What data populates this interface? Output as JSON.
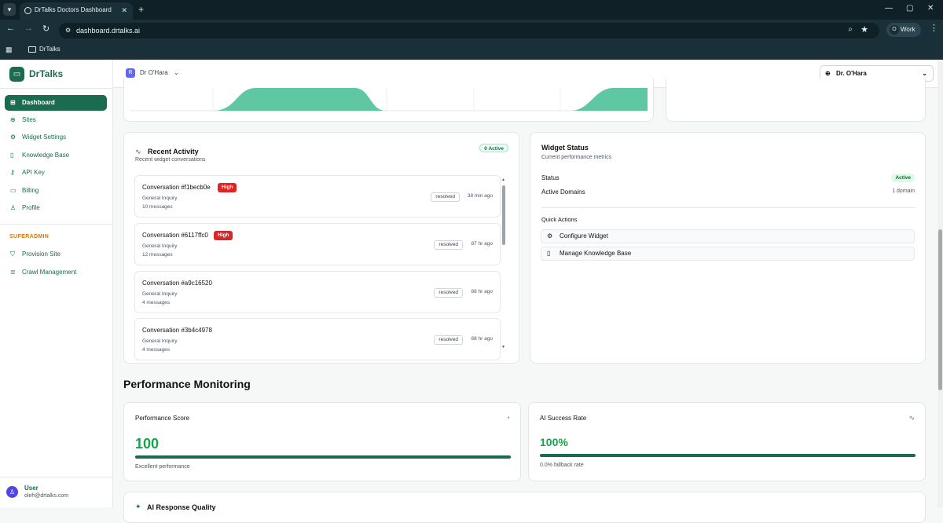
{
  "browser": {
    "tab_title": "DrTalks Doctors Dashboard",
    "url": "dashboard.drtalks.ai",
    "profile_label": "Work",
    "profile_initial": "O",
    "bookmark": "DrTalks"
  },
  "sidebar": {
    "brand": "DrTalks",
    "items": [
      {
        "label": "Dashboard",
        "icon": "grid-icon"
      },
      {
        "label": "Sites",
        "icon": "globe-icon"
      },
      {
        "label": "Widget Settings",
        "icon": "gear-icon"
      },
      {
        "label": "Knowledge Base",
        "icon": "book-icon"
      },
      {
        "label": "API Key",
        "icon": "key-icon"
      },
      {
        "label": "Billing",
        "icon": "card-icon"
      },
      {
        "label": "Profile",
        "icon": "user-icon"
      }
    ],
    "superadmin_label": "SUPERADMIN",
    "admin_items": [
      {
        "label": "Provision Site",
        "icon": "shield-icon"
      },
      {
        "label": "Crawl Management",
        "icon": "database-icon"
      }
    ],
    "user": {
      "name": "User",
      "email": "oleh@drtalks.com"
    }
  },
  "topbar": {
    "site_name": "Dr O'Hara",
    "site_icon_letter": "R",
    "doctor_select": "Dr. O'Hara"
  },
  "recent_activity": {
    "title": "Recent Activity",
    "subtitle": "Recent widget conversations",
    "active_badge": "0 Active",
    "conversations": [
      {
        "id": "Conversation #f1becb0e",
        "priority": "High",
        "type": "General Inquiry",
        "messages": "10 messages",
        "status": "resolved",
        "ago": "38 min ago"
      },
      {
        "id": "Conversation #6117ffc0",
        "priority": "High",
        "type": "General Inquiry",
        "messages": "12 messages",
        "status": "resolved",
        "ago": "87 hr ago"
      },
      {
        "id": "Conversation #a9c16520",
        "priority": "",
        "type": "General Inquiry",
        "messages": "4 messages",
        "status": "resolved",
        "ago": "88 hr ago"
      },
      {
        "id": "Conversation #3b4c4978",
        "priority": "",
        "type": "General Inquiry",
        "messages": "4 messages",
        "status": "resolved",
        "ago": "88 hr ago"
      }
    ]
  },
  "widget_status": {
    "title": "Widget Status",
    "subtitle": "Current performance metrics",
    "status_label": "Status",
    "status_value": "Active",
    "domains_label": "Active Domains",
    "domains_value": "1 domain",
    "quick_actions_label": "Quick Actions",
    "actions": [
      {
        "label": "Configure Widget",
        "icon": "gear-icon"
      },
      {
        "label": "Manage Knowledge Base",
        "icon": "book-icon"
      }
    ]
  },
  "performance": {
    "heading": "Performance Monitoring",
    "score_title": "Performance Score",
    "score_value": "100",
    "score_fraction": 1.0,
    "score_caption": "Excellent performance",
    "ai_title": "AI Success Rate",
    "ai_value": "100%",
    "ai_fraction": 1.0,
    "ai_caption": "0.0% fallback rate",
    "next_card_title": "AI Response Quality"
  },
  "colors": {
    "brand": "#1a6b50",
    "chart_fill": "#5fc8a3",
    "high": "#dc2626",
    "score": "#16a34a"
  }
}
